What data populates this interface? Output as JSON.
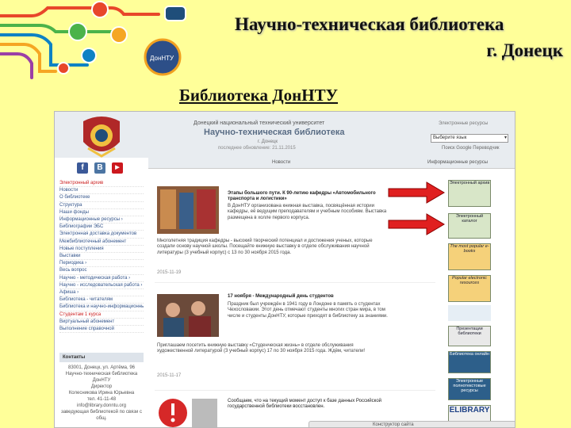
{
  "slide": {
    "title_line1": "Научно-техническая библиотека",
    "title_line2": "г. Донецк",
    "link_text": "Библиотека ДонНТУ",
    "logo_caption": "ДонНТУ"
  },
  "site": {
    "university": "Донецкий национальный технический университет",
    "library": "Научно-техническая библиотека",
    "city": "г. Донецк",
    "updated": "последнее обновление: 21.11.2015",
    "header_label": "Электронные ресурсы",
    "select_value": "Выберите язык",
    "search_label": "Поиск Google Переводчик",
    "social": [
      "f",
      "B",
      "▶"
    ],
    "tabs": [
      "Новости",
      "Информационные ресурсы"
    ],
    "nav": [
      "Электронный архив",
      "Новости",
      "О библиотеке",
      "Структура",
      "Наши фонды",
      "Информационные ресурсы ›",
      "Библиографии ЭБС",
      "Электронная доставка документов",
      "Межбиблиотечный абонемент",
      "Новые поступления",
      "Выставки",
      "Периодика ›",
      "Весь вопрос",
      "Научно - методическая работа ›",
      "Научно - исследовательская работа ›",
      "Афиша ›",
      "Библиотека - читателям",
      "Библиотека и научно-информационные центры",
      "Студентам 1 курса",
      "Виртуальный абонемент",
      "Выполнение справочной"
    ],
    "contacts": {
      "heading": "Контакты",
      "lines": [
        "83001, Донецк, ул. Артёма, 96",
        "Научно-техническая библиотека ДонНТУ",
        "Директор",
        "Колесникова Ирина Юрьевна",
        "тел. 41-11-48",
        "info@library.donntu.org",
        "заведующая библиотекой по связи с общ."
      ]
    },
    "news": [
      {
        "head": "Этапы большого пути. К 90-летию кафедры «Автомобильного транспорта и логистики»",
        "body": "В ДонНТУ организована книжная выставка, посвящённая истории кафедры, её ведущим преподавателям и учебным пособиям. Выставка размещена в холле первого корпуса.",
        "full": "Многолетняя традиция кафедры - высокий творческий потенциал и достижения ученых, которые создали основу научной школы. Посещайте книжную выставку в отделе обслуживания научной литературы (3 учебный корпус) с 13 по 30 ноября 2015 года.",
        "date": "2015-11-19"
      },
      {
        "head": "17 ноября - Международный день студентов",
        "body": "Праздник был учреждён в 1941 году в Лондоне в память о студентах Чехословакии. Этот день отмечают студенты многих стран мира, в том числе и студенты ДонНТУ, которые приходят в библиотеку за знаниями.",
        "full": "Приглашаем посетить книжную выставку «Студенческая жизнь» в отделе обслуживания художественной литературой (3 учебный корпус) 17 по 30 ноября 2015 года. Ждём, читатели!",
        "date": "2015-11-17"
      },
      {
        "head": "Сообщаем, что на текущий момент доступ к базе данных Российской государственной библиотеки восстановлен.",
        "body": "",
        "full": "",
        "date": ""
      }
    ],
    "read_more": "Ждём, читатели!",
    "banners": [
      "Электронный архив",
      "Электронный каталог",
      "The most popular e-books",
      "Popular electronic resources",
      "Презентации библиотеки",
      "Библиотека онлайн",
      "Электронные полнотекстовые ресурсы",
      "ELIBRARY"
    ],
    "browser_bar": "Конструктор сайта"
  }
}
